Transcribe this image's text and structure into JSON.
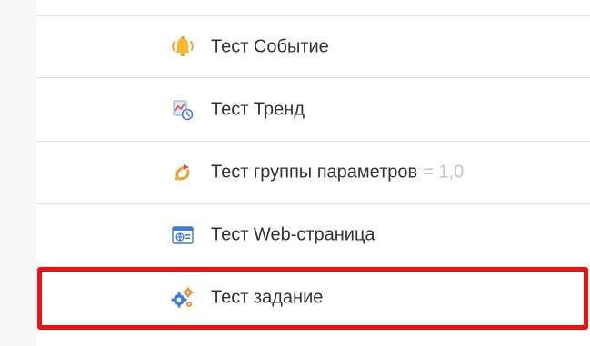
{
  "tree": {
    "items": [
      {
        "icon": "bell-icon",
        "label": "Тест Событие",
        "suffix": ""
      },
      {
        "icon": "trend-chart-icon",
        "label": "Тест Тренд",
        "suffix": ""
      },
      {
        "icon": "parameter-group-icon",
        "label": "Тест группы параметров",
        "suffix": "= 1,0"
      },
      {
        "icon": "web-page-icon",
        "label": "Тест Web-страница",
        "suffix": ""
      },
      {
        "icon": "task-gears-icon",
        "label": "Тест задание",
        "suffix": ""
      }
    ],
    "selected_index": 4
  },
  "colors": {
    "selection_border": "#ee1111",
    "text": "#333333",
    "suffix_text": "#c4c4c4",
    "divider": "#e5e5e5"
  }
}
